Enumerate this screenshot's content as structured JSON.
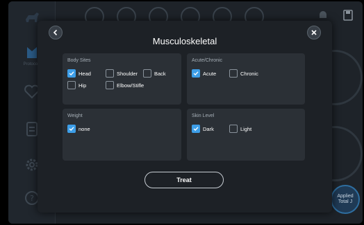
{
  "modal": {
    "title": "Musculoskeletal",
    "treat_label": "Treat"
  },
  "panels": {
    "body_sites": {
      "title": "Body Sites",
      "options": [
        {
          "label": "Head",
          "checked": true
        },
        {
          "label": "Shoulder",
          "checked": false
        },
        {
          "label": "Back",
          "checked": false
        },
        {
          "label": "Hip",
          "checked": false
        },
        {
          "label": "Elbow/Stifle",
          "checked": false
        }
      ]
    },
    "acute_chronic": {
      "title": "Acute/Chronic",
      "options": [
        {
          "label": "Acute",
          "checked": true
        },
        {
          "label": "Chronic",
          "checked": false
        }
      ]
    },
    "weight": {
      "title": "Weight",
      "options": [
        {
          "label": "none",
          "checked": true
        }
      ]
    },
    "skin_level": {
      "title": "Skin Level",
      "options": [
        {
          "label": "Dark",
          "checked": true
        },
        {
          "label": "Light",
          "checked": false
        }
      ]
    }
  },
  "background": {
    "sidebar_labels": [
      "Protocols",
      "",
      "",
      "",
      ""
    ],
    "applied_badge": [
      "Applied",
      "Total J"
    ]
  },
  "colors": {
    "accent": "#3d9ee8",
    "modal_bg": "#1d2126",
    "panel_bg": "#2b3036"
  }
}
